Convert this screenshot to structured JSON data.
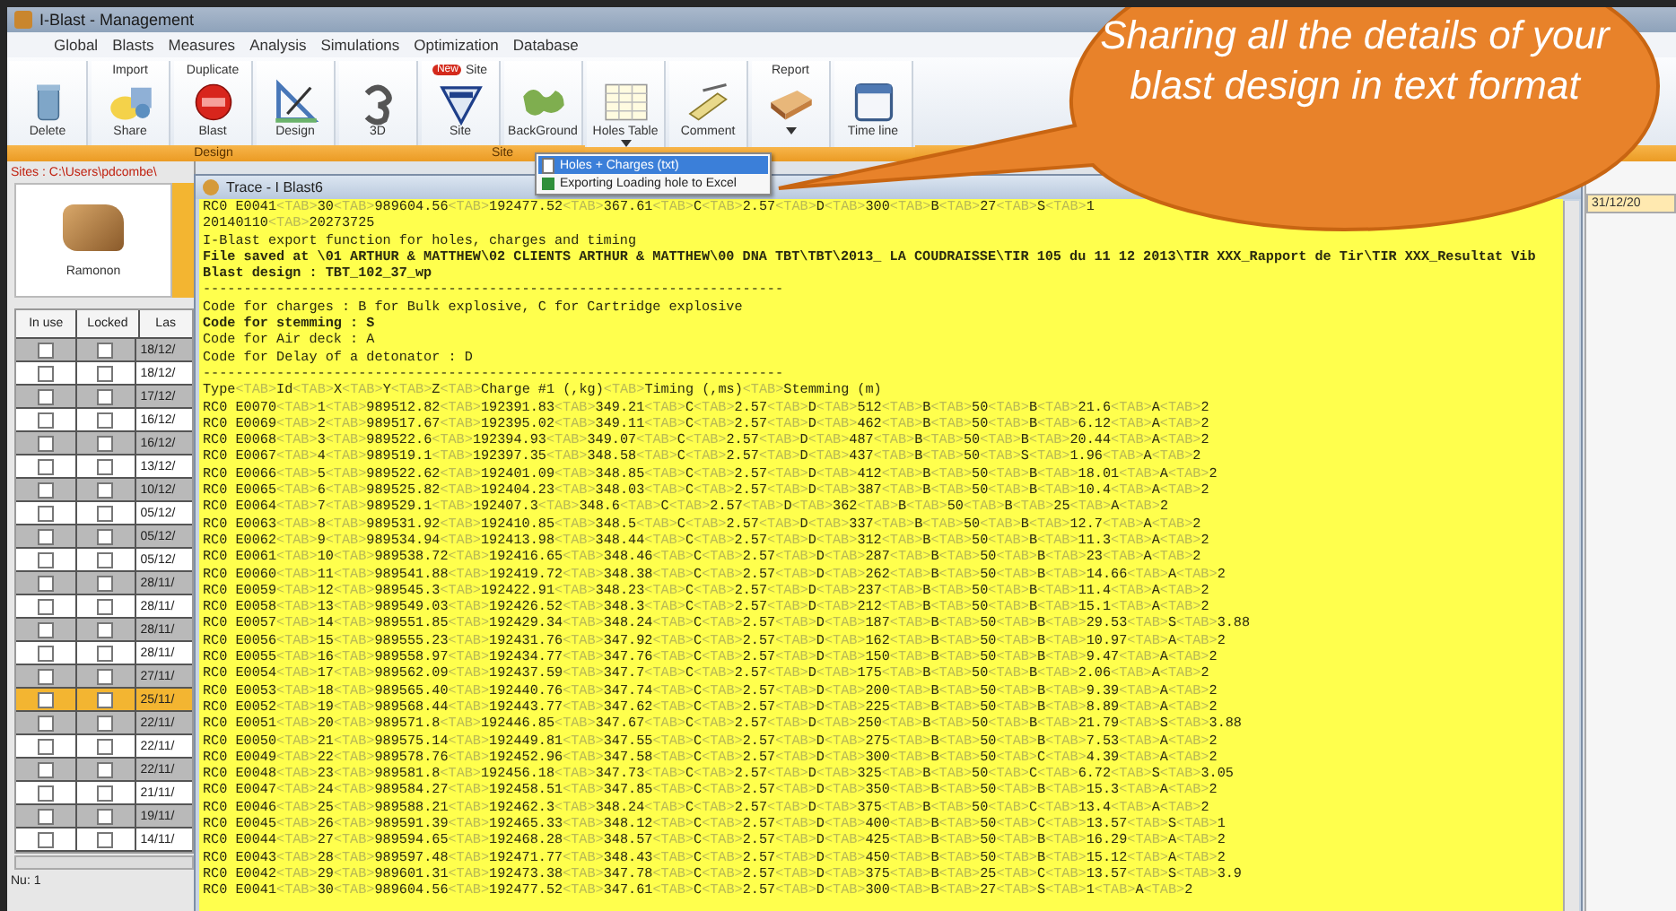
{
  "window": {
    "title": "I-Blast - Management"
  },
  "menu": [
    {
      "label": "Global"
    },
    {
      "label": "Blasts"
    },
    {
      "label": "Measures"
    },
    {
      "label": "Analysis"
    },
    {
      "label": "Simulations"
    },
    {
      "label": "Optimization"
    },
    {
      "label": "Database"
    }
  ],
  "ribbon": {
    "groups": [
      {
        "label": "Design",
        "buttons": [
          {
            "kind": "bin",
            "label": "Delete"
          },
          {
            "kind": "share",
            "top_label": "Import",
            "label": "Share"
          },
          {
            "kind": "new",
            "top_label": "Duplicate",
            "label": "Blast"
          },
          {
            "kind": "ruler",
            "label": "Design"
          },
          {
            "kind": "cube",
            "label": "3D"
          }
        ]
      },
      {
        "label": "Site",
        "buttons": [
          {
            "kind": "site",
            "top_label": "Site",
            "badge": "New",
            "label": "Site"
          },
          {
            "kind": "map",
            "label": "BackGround"
          }
        ]
      },
      {
        "buttons": [
          {
            "kind": "table",
            "label": "Holes Table",
            "dropdown": true
          },
          {
            "kind": "comment",
            "label": "Comment"
          },
          {
            "kind": "book",
            "top_label": "Report",
            "dropdown": true
          },
          {
            "kind": "calendar",
            "label": "Time line"
          }
        ]
      }
    ]
  },
  "dropdown": {
    "items": [
      {
        "label": "Holes + Charges (txt)",
        "selected": true,
        "kind": "text"
      },
      {
        "label": "Exporting Loading hole to Excel",
        "selected": false,
        "kind": "sheet"
      }
    ]
  },
  "sites": {
    "path": "Sites : C:\\Users\\pdcombe\\",
    "card_label": "Ramonon",
    "columns": [
      "In use",
      "Locked",
      "Las"
    ],
    "rows": [
      {
        "in_use": false,
        "locked": false,
        "date": "18/12/",
        "selected": false
      },
      {
        "in_use": false,
        "locked": false,
        "date": "18/12/",
        "selected": false
      },
      {
        "in_use": false,
        "locked": false,
        "date": "17/12/",
        "selected": false
      },
      {
        "in_use": false,
        "locked": false,
        "date": "16/12/",
        "selected": false
      },
      {
        "in_use": false,
        "locked": false,
        "date": "16/12/",
        "selected": false
      },
      {
        "in_use": false,
        "locked": false,
        "date": "13/12/",
        "selected": false
      },
      {
        "in_use": false,
        "locked": false,
        "date": "10/12/",
        "selected": false
      },
      {
        "in_use": false,
        "locked": false,
        "date": "05/12/",
        "selected": false
      },
      {
        "in_use": false,
        "locked": false,
        "date": "05/12/",
        "selected": false
      },
      {
        "in_use": false,
        "locked": false,
        "date": "05/12/",
        "selected": false
      },
      {
        "in_use": false,
        "locked": false,
        "date": "28/11/",
        "selected": false
      },
      {
        "in_use": false,
        "locked": false,
        "date": "28/11/",
        "selected": false
      },
      {
        "in_use": false,
        "locked": false,
        "date": "28/11/",
        "selected": false
      },
      {
        "in_use": false,
        "locked": false,
        "date": "28/11/",
        "selected": false
      },
      {
        "in_use": false,
        "locked": false,
        "date": "27/11/",
        "selected": false
      },
      {
        "in_use": false,
        "locked": false,
        "date": "25/11/",
        "selected": true
      },
      {
        "in_use": false,
        "locked": false,
        "date": "22/11/",
        "selected": false
      },
      {
        "in_use": false,
        "locked": false,
        "date": "22/11/",
        "selected": false
      },
      {
        "in_use": false,
        "locked": false,
        "date": "22/11/",
        "selected": false
      },
      {
        "in_use": false,
        "locked": false,
        "date": "21/11/",
        "selected": false
      },
      {
        "in_use": false,
        "locked": false,
        "date": "19/11/",
        "selected": false
      },
      {
        "in_use": false,
        "locked": false,
        "date": "14/11/",
        "selected": false
      }
    ],
    "status": "Nu: 1"
  },
  "right_panel": {
    "date": "31/12/20"
  },
  "trace": {
    "title": "Trace - I Blast6",
    "lines": [
      {
        "kind": "record",
        "fields": [
          "RC0 E0041",
          "<TAB>",
          "30",
          "<TAB>",
          "989604.56",
          "<TAB>",
          "192477.52",
          "<TAB>",
          "367.61",
          "<TAB>",
          "C",
          "<TAB>",
          "2.57",
          "<TAB>",
          "D",
          "<TAB>",
          "300",
          "<TAB>",
          "B",
          "<TAB>",
          "27",
          "<TAB>",
          "S",
          "<TAB>",
          "1"
        ]
      },
      {
        "kind": "record",
        "fields": [
          "20140110",
          "<TAB>",
          "20273725"
        ]
      },
      {
        "kind": "text",
        "bold": false,
        "text": "I-Blast export function for holes, charges and timing"
      },
      {
        "kind": "text",
        "bold": true,
        "text": "File saved at \\01 ARTHUR & MATTHEW\\02 CLIENTS ARTHUR & MATTHEW\\00 DNA TBT\\TBT\\2013_ LA COUDRAISSE\\TIR 105 du 11 12 2013\\TIR XXX_Rapport de Tir\\TIR XXX_Resultat Vib"
      },
      {
        "kind": "text",
        "bold": true,
        "text": "Blast design : TBT_102_37_wp"
      },
      {
        "kind": "text",
        "bold": false,
        "text": "-----------------------------------------------------------------------"
      },
      {
        "kind": "text",
        "bold": false,
        "text": "Code for charges : B for Bulk explosive, C for Cartridge explosive"
      },
      {
        "kind": "text",
        "bold": true,
        "text": "Code for stemming : S"
      },
      {
        "kind": "text",
        "bold": false,
        "text": "Code for Air deck : A"
      },
      {
        "kind": "text",
        "bold": false,
        "text": "Code for Delay of a detonator : D"
      },
      {
        "kind": "text",
        "bold": false,
        "text": "-----------------------------------------------------------------------"
      },
      {
        "kind": "record",
        "fields": [
          "Type",
          "<TAB>",
          "Id",
          "<TAB>",
          "X",
          "<TAB>",
          "Y",
          "<TAB>",
          "Z",
          "<TAB>",
          "Charge #1 (,kg)",
          "<TAB>",
          "Timing (,ms)",
          "<TAB>",
          "Stemming (m)"
        ]
      },
      {
        "kind": "record",
        "fields": [
          "RC0 E0070",
          "<TAB>",
          "1",
          "<TAB>",
          "989512.82",
          "<TAB>",
          "192391.83",
          "<TAB>",
          "349.21",
          "<TAB>",
          "C",
          "<TAB>",
          "2.57",
          "<TAB>",
          "D",
          "<TAB>",
          "512",
          "<TAB>",
          "B",
          "<TAB>",
          "50",
          "<TAB>",
          "B",
          "<TAB>",
          "21.6",
          "<TAB>",
          "A",
          "<TAB>",
          "2"
        ]
      },
      {
        "kind": "record",
        "fields": [
          "RC0 E0069",
          "<TAB>",
          "2",
          "<TAB>",
          "989517.67",
          "<TAB>",
          "192395.02",
          "<TAB>",
          "349.11",
          "<TAB>",
          "C",
          "<TAB>",
          "2.57",
          "<TAB>",
          "D",
          "<TAB>",
          "462",
          "<TAB>",
          "B",
          "<TAB>",
          "50",
          "<TAB>",
          "B",
          "<TAB>",
          "6.12",
          "<TAB>",
          "A",
          "<TAB>",
          "2"
        ]
      },
      {
        "kind": "record",
        "fields": [
          "RC0 E0068",
          "<TAB>",
          "3",
          "<TAB>",
          "989522.6",
          "<TAB>",
          "192394.93",
          "<TAB>",
          "349.07",
          "<TAB>",
          "C",
          "<TAB>",
          "2.57",
          "<TAB>",
          "D",
          "<TAB>",
          "487",
          "<TAB>",
          "B",
          "<TAB>",
          "50",
          "<TAB>",
          "B",
          "<TAB>",
          "20.44",
          "<TAB>",
          "A",
          "<TAB>",
          "2"
        ]
      },
      {
        "kind": "record",
        "fields": [
          "RC0 E0067",
          "<TAB>",
          "4",
          "<TAB>",
          "989519.1",
          "<TAB>",
          "192397.35",
          "<TAB>",
          "348.58",
          "<TAB>",
          "C",
          "<TAB>",
          "2.57",
          "<TAB>",
          "D",
          "<TAB>",
          "437",
          "<TAB>",
          "B",
          "<TAB>",
          "50",
          "<TAB>",
          "S",
          "<TAB>",
          "1.96",
          "<TAB>",
          "A",
          "<TAB>",
          "2"
        ]
      },
      {
        "kind": "record",
        "fields": [
          "RC0 E0066",
          "<TAB>",
          "5",
          "<TAB>",
          "989522.62",
          "<TAB>",
          "192401.09",
          "<TAB>",
          "348.85",
          "<TAB>",
          "C",
          "<TAB>",
          "2.57",
          "<TAB>",
          "D",
          "<TAB>",
          "412",
          "<TAB>",
          "B",
          "<TAB>",
          "50",
          "<TAB>",
          "B",
          "<TAB>",
          "18.01",
          "<TAB>",
          "A",
          "<TAB>",
          "2"
        ]
      },
      {
        "kind": "record",
        "fields": [
          "RC0 E0065",
          "<TAB>",
          "6",
          "<TAB>",
          "989525.82",
          "<TAB>",
          "192404.23",
          "<TAB>",
          "348.03",
          "<TAB>",
          "C",
          "<TAB>",
          "2.57",
          "<TAB>",
          "D",
          "<TAB>",
          "387",
          "<TAB>",
          "B",
          "<TAB>",
          "50",
          "<TAB>",
          "B",
          "<TAB>",
          "10.4",
          "<TAB>",
          "A",
          "<TAB>",
          "2"
        ]
      },
      {
        "kind": "record",
        "fields": [
          "RC0 E0064",
          "<TAB>",
          "7",
          "<TAB>",
          "989529.1",
          "<TAB>",
          "192407.3",
          "<TAB>",
          "348.6",
          "<TAB>",
          "C",
          "<TAB>",
          "2.57",
          "<TAB>",
          "D",
          "<TAB>",
          "362",
          "<TAB>",
          "B",
          "<TAB>",
          "50",
          "<TAB>",
          "B",
          "<TAB>",
          "25",
          "<TAB>",
          "A",
          "<TAB>",
          "2"
        ]
      },
      {
        "kind": "record",
        "fields": [
          "RC0 E0063",
          "<TAB>",
          "8",
          "<TAB>",
          "989531.92",
          "<TAB>",
          "192410.85",
          "<TAB>",
          "348.5",
          "<TAB>",
          "C",
          "<TAB>",
          "2.57",
          "<TAB>",
          "D",
          "<TAB>",
          "337",
          "<TAB>",
          "B",
          "<TAB>",
          "50",
          "<TAB>",
          "B",
          "<TAB>",
          "12.7",
          "<TAB>",
          "A",
          "<TAB>",
          "2"
        ]
      },
      {
        "kind": "record",
        "fields": [
          "RC0 E0062",
          "<TAB>",
          "9",
          "<TAB>",
          "989534.94",
          "<TAB>",
          "192413.98",
          "<TAB>",
          "348.44",
          "<TAB>",
          "C",
          "<TAB>",
          "2.57",
          "<TAB>",
          "D",
          "<TAB>",
          "312",
          "<TAB>",
          "B",
          "<TAB>",
          "50",
          "<TAB>",
          "B",
          "<TAB>",
          "11.3",
          "<TAB>",
          "A",
          "<TAB>",
          "2"
        ]
      },
      {
        "kind": "record",
        "fields": [
          "RC0 E0061",
          "<TAB>",
          "10",
          "<TAB>",
          "989538.72",
          "<TAB>",
          "192416.65",
          "<TAB>",
          "348.46",
          "<TAB>",
          "C",
          "<TAB>",
          "2.57",
          "<TAB>",
          "D",
          "<TAB>",
          "287",
          "<TAB>",
          "B",
          "<TAB>",
          "50",
          "<TAB>",
          "B",
          "<TAB>",
          "23",
          "<TAB>",
          "A",
          "<TAB>",
          "2"
        ]
      },
      {
        "kind": "record",
        "fields": [
          "RC0 E0060",
          "<TAB>",
          "11",
          "<TAB>",
          "989541.88",
          "<TAB>",
          "192419.72",
          "<TAB>",
          "348.38",
          "<TAB>",
          "C",
          "<TAB>",
          "2.57",
          "<TAB>",
          "D",
          "<TAB>",
          "262",
          "<TAB>",
          "B",
          "<TAB>",
          "50",
          "<TAB>",
          "B",
          "<TAB>",
          "14.66",
          "<TAB>",
          "A",
          "<TAB>",
          "2"
        ]
      },
      {
        "kind": "record",
        "fields": [
          "RC0 E0059",
          "<TAB>",
          "12",
          "<TAB>",
          "989545.3",
          "<TAB>",
          "192422.91",
          "<TAB>",
          "348.23",
          "<TAB>",
          "C",
          "<TAB>",
          "2.57",
          "<TAB>",
          "D",
          "<TAB>",
          "237",
          "<TAB>",
          "B",
          "<TAB>",
          "50",
          "<TAB>",
          "B",
          "<TAB>",
          "11.4",
          "<TAB>",
          "A",
          "<TAB>",
          "2"
        ]
      },
      {
        "kind": "record",
        "fields": [
          "RC0 E0058",
          "<TAB>",
          "13",
          "<TAB>",
          "989549.03",
          "<TAB>",
          "192426.52",
          "<TAB>",
          "348.3",
          "<TAB>",
          "C",
          "<TAB>",
          "2.57",
          "<TAB>",
          "D",
          "<TAB>",
          "212",
          "<TAB>",
          "B",
          "<TAB>",
          "50",
          "<TAB>",
          "B",
          "<TAB>",
          "15.1",
          "<TAB>",
          "A",
          "<TAB>",
          "2"
        ]
      },
      {
        "kind": "record",
        "fields": [
          "RC0 E0057",
          "<TAB>",
          "14",
          "<TAB>",
          "989551.85",
          "<TAB>",
          "192429.34",
          "<TAB>",
          "348.24",
          "<TAB>",
          "C",
          "<TAB>",
          "2.57",
          "<TAB>",
          "D",
          "<TAB>",
          "187",
          "<TAB>",
          "B",
          "<TAB>",
          "50",
          "<TAB>",
          "B",
          "<TAB>",
          "29.53",
          "<TAB>",
          "S",
          "<TAB>",
          "3.88"
        ]
      },
      {
        "kind": "record",
        "fields": [
          "RC0 E0056",
          "<TAB>",
          "15",
          "<TAB>",
          "989555.23",
          "<TAB>",
          "192431.76",
          "<TAB>",
          "347.92",
          "<TAB>",
          "C",
          "<TAB>",
          "2.57",
          "<TAB>",
          "D",
          "<TAB>",
          "162",
          "<TAB>",
          "B",
          "<TAB>",
          "50",
          "<TAB>",
          "B",
          "<TAB>",
          "10.97",
          "<TAB>",
          "A",
          "<TAB>",
          "2"
        ]
      },
      {
        "kind": "record",
        "fields": [
          "RC0 E0055",
          "<TAB>",
          "16",
          "<TAB>",
          "989558.97",
          "<TAB>",
          "192434.77",
          "<TAB>",
          "347.76",
          "<TAB>",
          "C",
          "<TAB>",
          "2.57",
          "<TAB>",
          "D",
          "<TAB>",
          "150",
          "<TAB>",
          "B",
          "<TAB>",
          "50",
          "<TAB>",
          "B",
          "<TAB>",
          "9.47",
          "<TAB>",
          "A",
          "<TAB>",
          "2"
        ]
      },
      {
        "kind": "record",
        "fields": [
          "RC0 E0054",
          "<TAB>",
          "17",
          "<TAB>",
          "989562.09",
          "<TAB>",
          "192437.59",
          "<TAB>",
          "347.7",
          "<TAB>",
          "C",
          "<TAB>",
          "2.57",
          "<TAB>",
          "D",
          "<TAB>",
          "175",
          "<TAB>",
          "B",
          "<TAB>",
          "50",
          "<TAB>",
          "B",
          "<TAB>",
          "2.06",
          "<TAB>",
          "A",
          "<TAB>",
          "2"
        ]
      },
      {
        "kind": "record",
        "fields": [
          "RC0 E0053",
          "<TAB>",
          "18",
          "<TAB>",
          "989565.40",
          "<TAB>",
          "192440.76",
          "<TAB>",
          "347.74",
          "<TAB>",
          "C",
          "<TAB>",
          "2.57",
          "<TAB>",
          "D",
          "<TAB>",
          "200",
          "<TAB>",
          "B",
          "<TAB>",
          "50",
          "<TAB>",
          "B",
          "<TAB>",
          "9.39",
          "<TAB>",
          "A",
          "<TAB>",
          "2"
        ]
      },
      {
        "kind": "record",
        "fields": [
          "RC0 E0052",
          "<TAB>",
          "19",
          "<TAB>",
          "989568.44",
          "<TAB>",
          "192443.77",
          "<TAB>",
          "347.62",
          "<TAB>",
          "C",
          "<TAB>",
          "2.57",
          "<TAB>",
          "D",
          "<TAB>",
          "225",
          "<TAB>",
          "B",
          "<TAB>",
          "50",
          "<TAB>",
          "B",
          "<TAB>",
          "8.89",
          "<TAB>",
          "A",
          "<TAB>",
          "2"
        ]
      },
      {
        "kind": "record",
        "fields": [
          "RC0 E0051",
          "<TAB>",
          "20",
          "<TAB>",
          "989571.8",
          "<TAB>",
          "192446.85",
          "<TAB>",
          "347.67",
          "<TAB>",
          "C",
          "<TAB>",
          "2.57",
          "<TAB>",
          "D",
          "<TAB>",
          "250",
          "<TAB>",
          "B",
          "<TAB>",
          "50",
          "<TAB>",
          "B",
          "<TAB>",
          "21.79",
          "<TAB>",
          "S",
          "<TAB>",
          "3.88"
        ]
      },
      {
        "kind": "record",
        "fields": [
          "RC0 E0050",
          "<TAB>",
          "21",
          "<TAB>",
          "989575.14",
          "<TAB>",
          "192449.81",
          "<TAB>",
          "347.55",
          "<TAB>",
          "C",
          "<TAB>",
          "2.57",
          "<TAB>",
          "D",
          "<TAB>",
          "275",
          "<TAB>",
          "B",
          "<TAB>",
          "50",
          "<TAB>",
          "B",
          "<TAB>",
          "7.53",
          "<TAB>",
          "A",
          "<TAB>",
          "2"
        ]
      },
      {
        "kind": "record",
        "fields": [
          "RC0 E0049",
          "<TAB>",
          "22",
          "<TAB>",
          "989578.76",
          "<TAB>",
          "192452.96",
          "<TAB>",
          "347.58",
          "<TAB>",
          "C",
          "<TAB>",
          "2.57",
          "<TAB>",
          "D",
          "<TAB>",
          "300",
          "<TAB>",
          "B",
          "<TAB>",
          "50",
          "<TAB>",
          "C",
          "<TAB>",
          "4.39",
          "<TAB>",
          "A",
          "<TAB>",
          "2"
        ]
      },
      {
        "kind": "record",
        "fields": [
          "RC0 E0048",
          "<TAB>",
          "23",
          "<TAB>",
          "989581.8",
          "<TAB>",
          "192456.18",
          "<TAB>",
          "347.73",
          "<TAB>",
          "C",
          "<TAB>",
          "2.57",
          "<TAB>",
          "D",
          "<TAB>",
          "325",
          "<TAB>",
          "B",
          "<TAB>",
          "50",
          "<TAB>",
          "C",
          "<TAB>",
          "6.72",
          "<TAB>",
          "S",
          "<TAB>",
          "3.05"
        ]
      },
      {
        "kind": "record",
        "fields": [
          "RC0 E0047",
          "<TAB>",
          "24",
          "<TAB>",
          "989584.27",
          "<TAB>",
          "192458.51",
          "<TAB>",
          "347.85",
          "<TAB>",
          "C",
          "<TAB>",
          "2.57",
          "<TAB>",
          "D",
          "<TAB>",
          "350",
          "<TAB>",
          "B",
          "<TAB>",
          "50",
          "<TAB>",
          "B",
          "<TAB>",
          "15.3",
          "<TAB>",
          "A",
          "<TAB>",
          "2"
        ]
      },
      {
        "kind": "record",
        "fields": [
          "RC0 E0046",
          "<TAB>",
          "25",
          "<TAB>",
          "989588.21",
          "<TAB>",
          "192462.3",
          "<TAB>",
          "348.24",
          "<TAB>",
          "C",
          "<TAB>",
          "2.57",
          "<TAB>",
          "D",
          "<TAB>",
          "375",
          "<TAB>",
          "B",
          "<TAB>",
          "50",
          "<TAB>",
          "C",
          "<TAB>",
          "13.4",
          "<TAB>",
          "A",
          "<TAB>",
          "2"
        ]
      },
      {
        "kind": "record",
        "fields": [
          "RC0 E0045",
          "<TAB>",
          "26",
          "<TAB>",
          "989591.39",
          "<TAB>",
          "192465.33",
          "<TAB>",
          "348.12",
          "<TAB>",
          "C",
          "<TAB>",
          "2.57",
          "<TAB>",
          "D",
          "<TAB>",
          "400",
          "<TAB>",
          "B",
          "<TAB>",
          "50",
          "<TAB>",
          "C",
          "<TAB>",
          "13.57",
          "<TAB>",
          "S",
          "<TAB>",
          "1"
        ]
      },
      {
        "kind": "record",
        "fields": [
          "RC0 E0044",
          "<TAB>",
          "27",
          "<TAB>",
          "989594.65",
          "<TAB>",
          "192468.28",
          "<TAB>",
          "348.57",
          "<TAB>",
          "C",
          "<TAB>",
          "2.57",
          "<TAB>",
          "D",
          "<TAB>",
          "425",
          "<TAB>",
          "B",
          "<TAB>",
          "50",
          "<TAB>",
          "B",
          "<TAB>",
          "16.29",
          "<TAB>",
          "A",
          "<TAB>",
          "2"
        ]
      },
      {
        "kind": "record",
        "fields": [
          "RC0 E0043",
          "<TAB>",
          "28",
          "<TAB>",
          "989597.48",
          "<TAB>",
          "192471.77",
          "<TAB>",
          "348.43",
          "<TAB>",
          "C",
          "<TAB>",
          "2.57",
          "<TAB>",
          "D",
          "<TAB>",
          "450",
          "<TAB>",
          "B",
          "<TAB>",
          "50",
          "<TAB>",
          "B",
          "<TAB>",
          "15.12",
          "<TAB>",
          "A",
          "<TAB>",
          "2"
        ]
      },
      {
        "kind": "record",
        "fields": [
          "RC0 E0042",
          "<TAB>",
          "29",
          "<TAB>",
          "989601.31",
          "<TAB>",
          "192473.38",
          "<TAB>",
          "347.78",
          "<TAB>",
          "C",
          "<TAB>",
          "2.57",
          "<TAB>",
          "D",
          "<TAB>",
          "375",
          "<TAB>",
          "B",
          "<TAB>",
          "25",
          "<TAB>",
          "C",
          "<TAB>",
          "13.57",
          "<TAB>",
          "S",
          "<TAB>",
          "3.9"
        ]
      },
      {
        "kind": "record",
        "fields": [
          "RC0 E0041",
          "<TAB>",
          "30",
          "<TAB>",
          "989604.56",
          "<TAB>",
          "192477.52",
          "<TAB>",
          "347.61",
          "<TAB>",
          "C",
          "<TAB>",
          "2.57",
          "<TAB>",
          "D",
          "<TAB>",
          "300",
          "<TAB>",
          "B",
          "<TAB>",
          "27",
          "<TAB>",
          "S",
          "<TAB>",
          "1",
          "<TAB>",
          "A",
          "<TAB>",
          "2"
        ]
      }
    ]
  },
  "callout": {
    "text": "Sharing all the details of your blast design in text format"
  }
}
